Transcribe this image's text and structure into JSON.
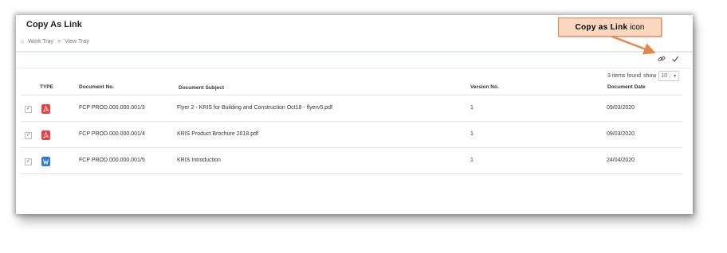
{
  "page": {
    "title": "Copy As Link",
    "breadcrumb": [
      "Work Tray",
      "View Tray"
    ]
  },
  "toolbar": {
    "copy_link_icon": "link-icon",
    "select_icon": "checkmark-icon"
  },
  "pagination": {
    "found_text": "3 items found",
    "show_label": "show",
    "show_value": "10"
  },
  "table": {
    "columns": {
      "type": "TYPE",
      "doc_no": "Document No.",
      "subject": "Document Subject",
      "version": "Version No.",
      "date": "Document Date"
    },
    "rows": [
      {
        "checked": "✓",
        "file_type": "pdf",
        "doc_no": "FCP PROD.000.000.001/3",
        "subject": "Flyer 2 - KRIS for Building and Construction Oct18 - flyerv5.pdf",
        "version": "1",
        "date": "09/03/2020"
      },
      {
        "checked": "✓",
        "file_type": "pdf",
        "doc_no": "FCP PROD.000.000.001/4",
        "subject": "KRIS Product Brochure 2018.pdf",
        "version": "1",
        "date": "09/03/2020"
      },
      {
        "checked": "✓",
        "file_type": "word",
        "doc_no": "FCP PROD.000.000.001/5",
        "subject": "KRIS Introduction",
        "version": "1",
        "date": "24/04/2020"
      }
    ]
  },
  "callout": {
    "bold_text": "Copy as Link",
    "text": "icon"
  },
  "colors": {
    "pdf": "#e8413f",
    "word": "#2f78d8",
    "callout_bg": "#fbd7bf",
    "callout_border": "#e6874a"
  }
}
